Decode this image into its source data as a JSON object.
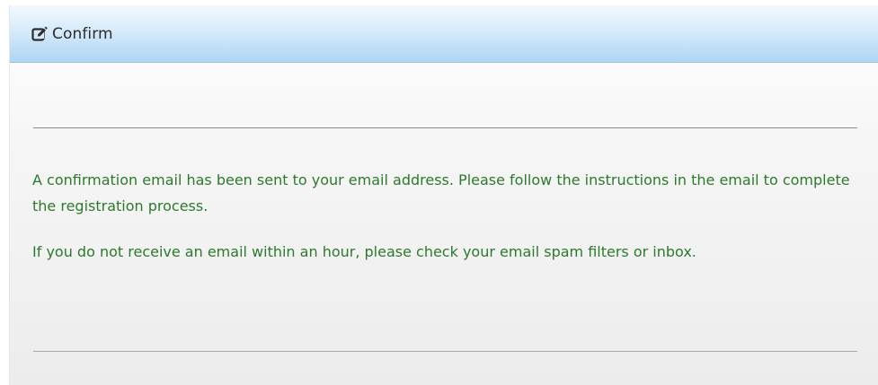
{
  "dialog": {
    "title": "Confirm",
    "title_icon": "edit-icon",
    "messages": [
      "A confirmation email has been sent to your email address. Please follow the instructions in the email to complete the registration process.",
      "If you do not receive an email within an hour, please check your email spam filters or inbox."
    ]
  },
  "colors": {
    "header_gradient_top": "#f2f9fe",
    "header_gradient_bottom": "#aed5f2",
    "message_text": "#2c7a2c",
    "title_text": "#2c2c2c",
    "divider": "#8c8c8c"
  }
}
